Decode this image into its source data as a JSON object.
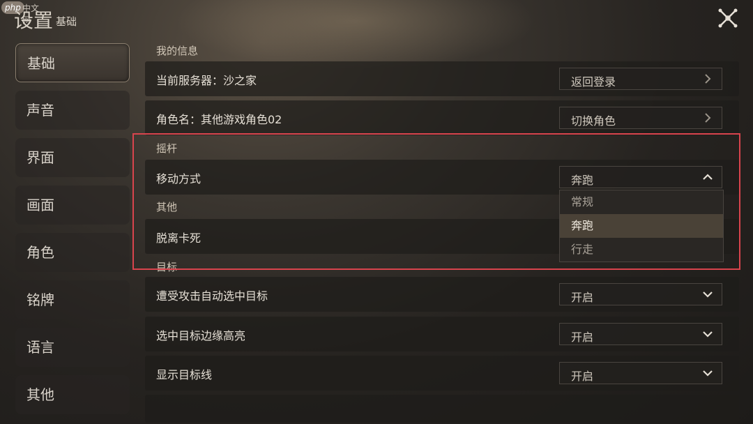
{
  "watermark": {
    "badge": "php",
    "text": "中文网"
  },
  "header": {
    "title": "设置",
    "subtitle": "基础"
  },
  "sidebar": {
    "items": [
      {
        "label": "基础",
        "active": true
      },
      {
        "label": "声音",
        "active": false
      },
      {
        "label": "界面",
        "active": false
      },
      {
        "label": "画面",
        "active": false
      },
      {
        "label": "角色",
        "active": false
      },
      {
        "label": "铭牌",
        "active": false
      },
      {
        "label": "语言",
        "active": false
      },
      {
        "label": "其他",
        "active": false
      }
    ]
  },
  "sections": {
    "info": "我的信息",
    "joystick": "摇杆",
    "other": "其他",
    "target": "目标"
  },
  "rows": {
    "server": {
      "label": "当前服务器：沙之家",
      "button": "返回登录"
    },
    "role": {
      "label": "角色名：其他游戏角色02",
      "button": "切换角色"
    },
    "move": {
      "label": "移动方式",
      "value": "奔跑"
    },
    "unstuck": {
      "label": "脱离卡死"
    },
    "auto_target": {
      "label": "遭受攻击自动选中目标",
      "value": "开启"
    },
    "edge_highlight": {
      "label": "选中目标边缘高亮",
      "value": "开启"
    },
    "target_line": {
      "label": "显示目标线",
      "value": "开启"
    }
  },
  "move_dropdown": {
    "options": [
      "常规",
      "奔跑",
      "行走"
    ],
    "selected": "奔跑"
  },
  "colors": {
    "accent_border": "#8a7e6e",
    "highlight": "#d9444d",
    "selected_option": "#4a4237"
  }
}
